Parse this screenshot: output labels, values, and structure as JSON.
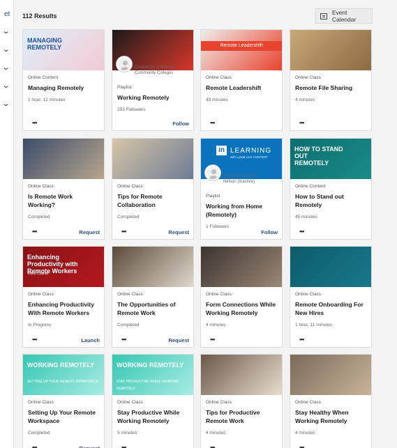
{
  "sidebar": {
    "fragment": "et",
    "chevrons": 6
  },
  "header": {
    "results": "112 Results",
    "calendar_button": "Event Calendar"
  },
  "cards": [
    {
      "type": "Online Content",
      "title": "Managing Remotely",
      "meta": "1 hour, 12 minutes",
      "action": "",
      "thumb_text": "MANAGING REMOTELY",
      "thumb_colors": [
        "#dff0f8",
        "#f2c9d6"
      ]
    },
    {
      "type": "Playlist",
      "title": "Working Remotely",
      "meta": "253 Followers",
      "action": "Follow",
      "creator": "Created by California Community Colleges",
      "thumb_colors": [
        "#1a1a1a",
        "#d8372b"
      ]
    },
    {
      "type": "Online Class",
      "title": "Remote Leadershift",
      "meta": "43 minutes",
      "action": "",
      "thumb_text": "Remote Leadershift",
      "thumb_colors": [
        "#f0ecea",
        "#e8432e"
      ]
    },
    {
      "type": "Online Class",
      "title": "Remote File Sharing",
      "meta": "4 minutes",
      "action": "",
      "thumb_colors": [
        "#c9a877",
        "#8c6a44"
      ]
    },
    {
      "type": "Online Class",
      "title": "Is Remote Work Working?",
      "meta": "Completed",
      "action": "Request",
      "thumb_colors": [
        "#3b4d6b",
        "#b8a58d"
      ]
    },
    {
      "type": "Online Class",
      "title": "Tips for Remote Collaboration",
      "meta": "Completed",
      "action": "Request",
      "thumb_colors": [
        "#d6c6a8",
        "#6e7c95"
      ]
    },
    {
      "type": "Playlist",
      "title": "Working from Home (Remotely)",
      "meta": "1 Followers",
      "action": "Follow",
      "creator": "Created by Kristen Nelson (Inactive)",
      "thumb_text": "LEARNING",
      "thumb_sub": "with Lynda.com CONTENT",
      "thumb_colors": [
        "#0a73bd",
        "#0a73bd"
      ]
    },
    {
      "type": "Online Content",
      "title": "How to Stand out Remotely",
      "meta": "45 minutes",
      "action": "",
      "thumb_text": "HOW TO STAND OUT REMOTELY",
      "thumb_colors": [
        "#0d6e6e",
        "#1a8b88"
      ]
    },
    {
      "type": "Online Class",
      "title": "Enhancing Productivity With Remote Workers",
      "meta": "In Progress",
      "action": "Launch",
      "thumb_text": "Enhancing Productivity with Remote Workers",
      "thumb_sub": "Video Course",
      "thumb_colors": [
        "#8a1216",
        "#b3191f"
      ]
    },
    {
      "type": "Online Class",
      "title": "The Opportunities of Remote Work",
      "meta": "Completed",
      "action": "Request",
      "thumb_colors": [
        "#5a4a3a",
        "#e0d8cc"
      ]
    },
    {
      "type": "Online Class",
      "title": "Form Connections While Working Remotely",
      "meta": "4 minutes",
      "action": "",
      "thumb_colors": [
        "#3b3430",
        "#9b8877"
      ]
    },
    {
      "type": "Online Class",
      "title": "Remote Onboarding For New Hires",
      "meta": "1 hour, 11 minutes",
      "action": "",
      "thumb_colors": [
        "#0e5b6b",
        "#16798b"
      ]
    },
    {
      "type": "Online Class",
      "title": "Setting Up Your Remote Workspace",
      "meta": "Completed",
      "action": "Request",
      "thumb_text": "WORKING REMOTELY",
      "thumb_sub": "SETTING UP YOUR REMOTE WORKSPACE",
      "thumb_colors": [
        "#37c7b3",
        "#a7ece2"
      ]
    },
    {
      "type": "Online Class",
      "title": "Stay Productive While Working Remotely",
      "meta": "5 minutes",
      "action": "",
      "thumb_text": "WORKING REMOTELY",
      "thumb_sub": "STAY PRODUCTIVE WHILE WORKING REMOTELY",
      "thumb_colors": [
        "#37c7b3",
        "#a7ece2"
      ]
    },
    {
      "type": "Online Class",
      "title": "Tips for Productive Remote Work",
      "meta": "4 minutes",
      "action": "",
      "thumb_colors": [
        "#6b5848",
        "#e8ddd0"
      ]
    },
    {
      "type": "Online Class",
      "title": "Stay Healthy When Working Remotely",
      "meta": "4 minutes",
      "action": "",
      "thumb_colors": [
        "#7a6a58",
        "#c9b49a"
      ]
    }
  ]
}
